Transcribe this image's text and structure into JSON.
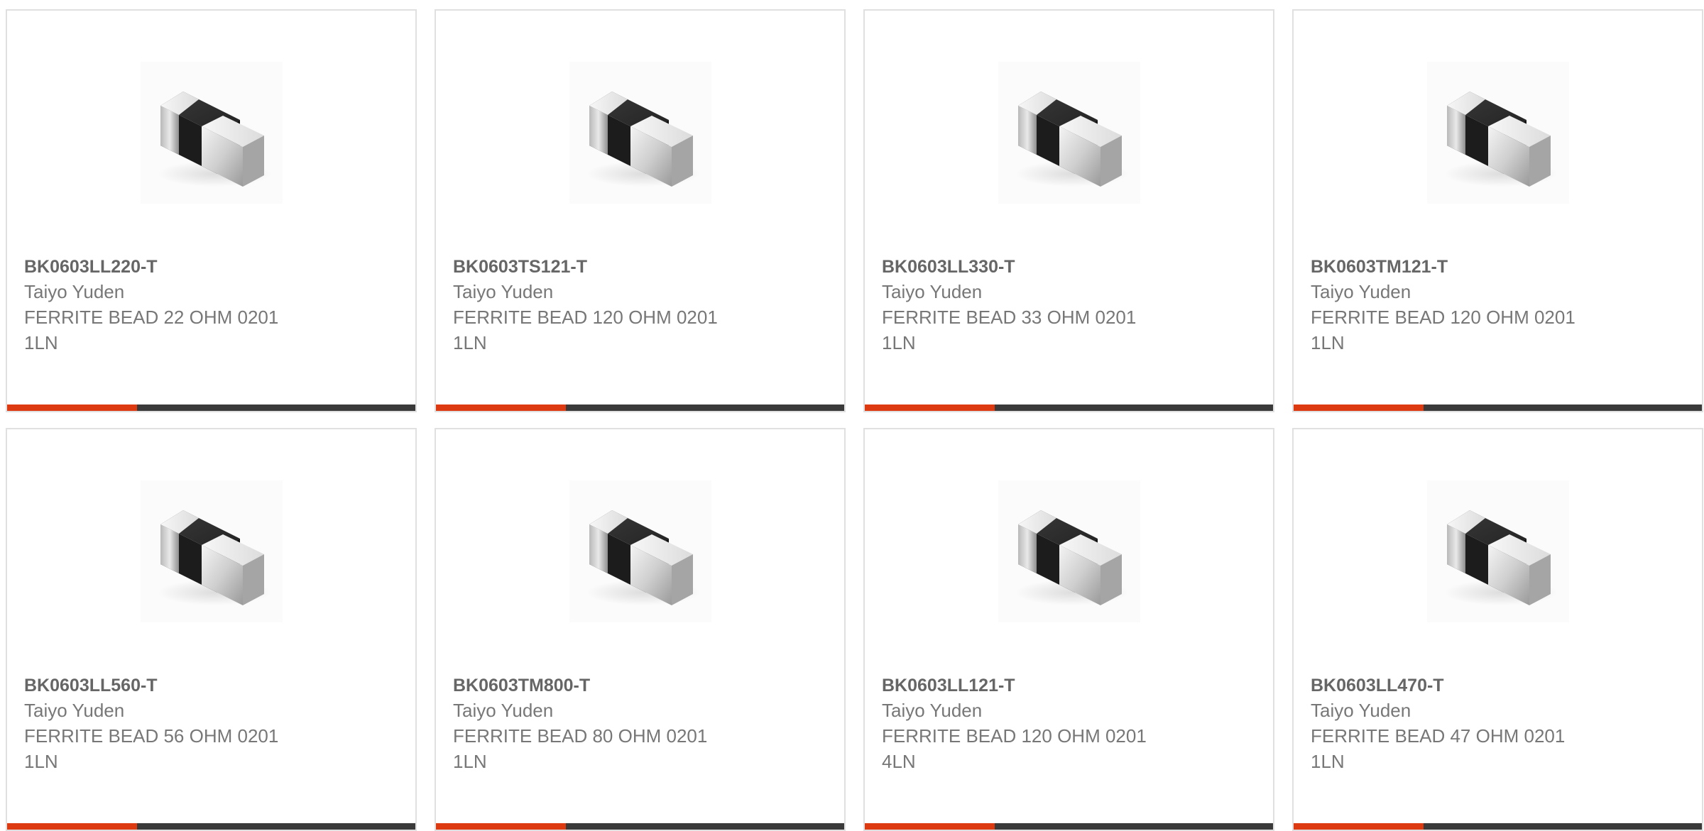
{
  "colors": {
    "card_border": "#e0e0e0",
    "part_number_text": "#666666",
    "detail_text": "#777777",
    "bar_dark": "#3a3a3a",
    "bar_accent": "#de3a12"
  },
  "products": [
    {
      "part_number": "BK0603LL220-T",
      "manufacturer": "Taiyo Yuden",
      "description": "FERRITE BEAD 22 OHM 0201",
      "lines": "1LN",
      "image_icon": "ferrite-bead-chip-icon"
    },
    {
      "part_number": "BK0603TS121-T",
      "manufacturer": "Taiyo Yuden",
      "description": "FERRITE BEAD 120 OHM 0201",
      "lines": "1LN",
      "image_icon": "ferrite-bead-chip-icon"
    },
    {
      "part_number": "BK0603LL330-T",
      "manufacturer": "Taiyo Yuden",
      "description": "FERRITE BEAD 33 OHM 0201",
      "lines": "1LN",
      "image_icon": "ferrite-bead-chip-icon"
    },
    {
      "part_number": "BK0603TM121-T",
      "manufacturer": "Taiyo Yuden",
      "description": "FERRITE BEAD 120 OHM 0201",
      "lines": "1LN",
      "image_icon": "ferrite-bead-chip-icon"
    },
    {
      "part_number": "BK0603LL560-T",
      "manufacturer": "Taiyo Yuden",
      "description": "FERRITE BEAD 56 OHM 0201",
      "lines": "1LN",
      "image_icon": "ferrite-bead-chip-icon"
    },
    {
      "part_number": "BK0603TM800-T",
      "manufacturer": "Taiyo Yuden",
      "description": "FERRITE BEAD 80 OHM 0201",
      "lines": "1LN",
      "image_icon": "ferrite-bead-chip-icon"
    },
    {
      "part_number": "BK0603LL121-T",
      "manufacturer": "Taiyo Yuden",
      "description": "FERRITE BEAD 120 OHM 0201",
      "lines": "4LN",
      "image_icon": "ferrite-bead-chip-icon"
    },
    {
      "part_number": "BK0603LL470-T",
      "manufacturer": "Taiyo Yuden",
      "description": "FERRITE BEAD 47 OHM 0201",
      "lines": "1LN",
      "image_icon": "ferrite-bead-chip-icon"
    }
  ]
}
